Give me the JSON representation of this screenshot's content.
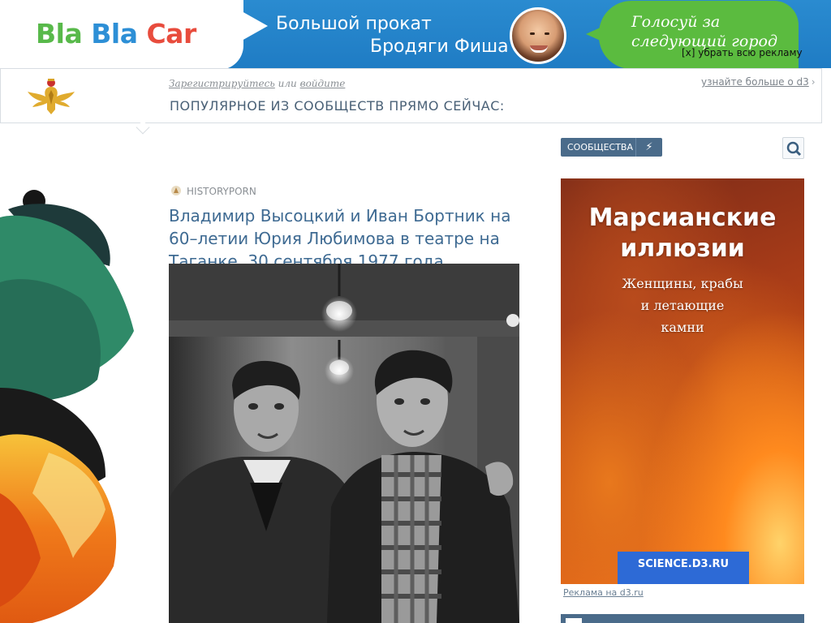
{
  "banner": {
    "logo": {
      "w1": "Bla",
      "w2": "Bla",
      "w3": "Car"
    },
    "line1": "Большой прокат",
    "line2": "Бродяги Фиша",
    "vote_line1": "Голосуй за",
    "vote_line2": "следующий город",
    "remove_ads": "[x] убрать всю рекламу"
  },
  "header": {
    "register": "Зарегистрируйтесь",
    "or": "или",
    "login": "войдите",
    "learn_more": "узнайте больше о d3",
    "popular": "ПОПУЛЯРНОЕ ИЗ СООБЩЕСТВ ПРЯМО СЕЙЧАС:"
  },
  "post": {
    "community": "HISTORYPORN",
    "title": "Владимир Высоцкий и Иван Бортник на 60–летии Юрия Любимова в театре на Таганке. 30 сентября 1977 года"
  },
  "sidebar": {
    "communities_button": "СООБЩЕСТВА",
    "bolt_icon": "bolt-icon",
    "search_icon": "search-icon",
    "ad": {
      "title_line1": "Марсианские",
      "title_line2": "иллюзии",
      "sub_line1": "Женщины, крабы",
      "sub_line2": "и летающие",
      "sub_line3": "камни",
      "button": "SCIENCE.D3.RU"
    },
    "ad_note": "Реклама на d3.ru"
  },
  "colors": {
    "link_blue": "#3e6a92",
    "button_slate": "#4a6b8a",
    "banner_blue": "#1f7cc4",
    "bubble_green": "#5bbb3f"
  }
}
